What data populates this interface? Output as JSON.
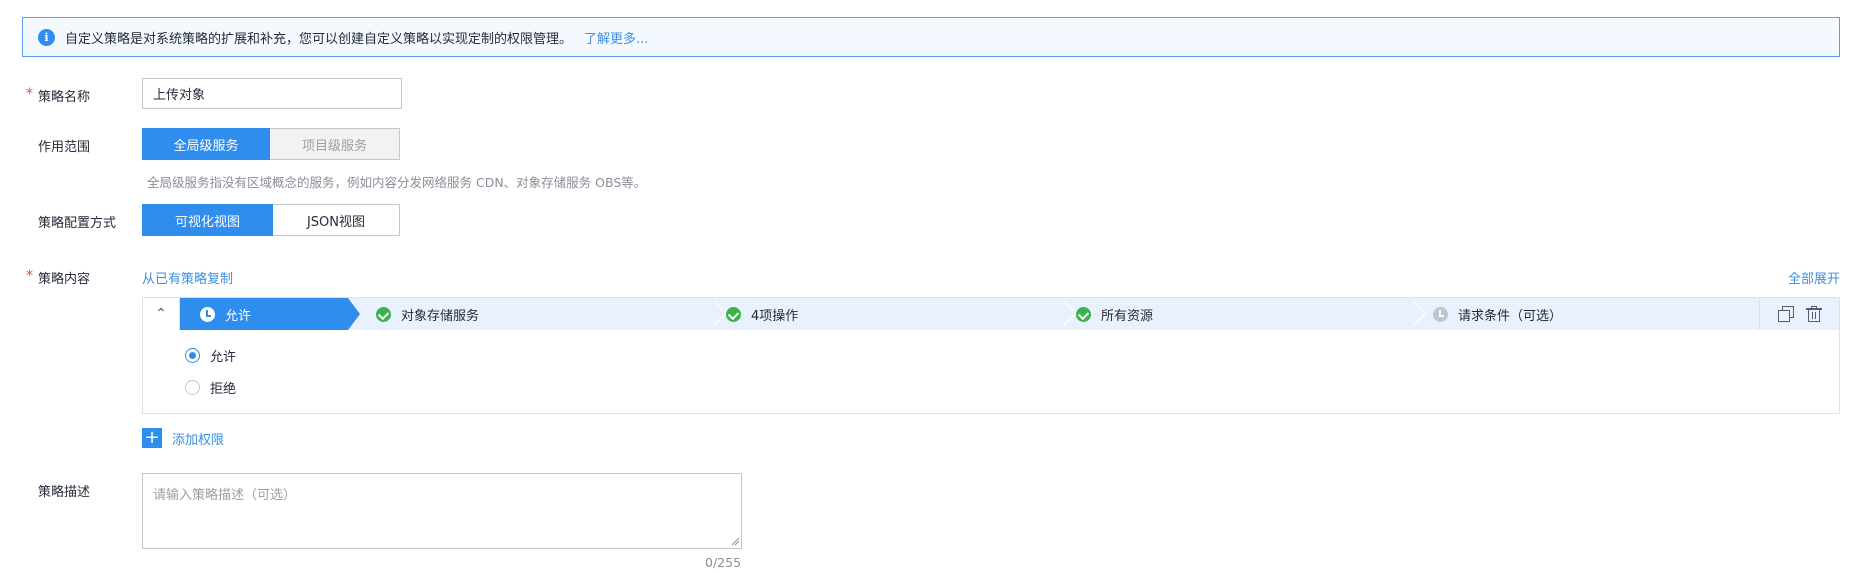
{
  "info": {
    "icon": "i",
    "text": "自定义策略是对系统策略的扩展和补充，您可以创建自定义策略以实现定制的权限管理。",
    "link": "了解更多..."
  },
  "policy_name": {
    "required_mark": "*",
    "label": "策略名称",
    "value": "上传对象"
  },
  "scope": {
    "label": "作用范围",
    "options": [
      "全局级服务",
      "项目级服务"
    ],
    "selected": "全局级服务",
    "hint": "全局级服务指没有区域概念的服务，例如内容分发网络服务 CDN、对象存储服务 OBS等。"
  },
  "config_mode": {
    "label": "策略配置方式",
    "options": [
      "可视化视图",
      "JSON视图"
    ],
    "selected": "可视化视图"
  },
  "content": {
    "required_mark": "*",
    "label": "策略内容",
    "copy_link": "从已有策略复制",
    "expand_link": "全部展开",
    "steps": [
      {
        "label": "允许",
        "state": "active"
      },
      {
        "label": "对象存储服务",
        "state": "done"
      },
      {
        "label": "4项操作",
        "state": "done"
      },
      {
        "label": "所有资源",
        "state": "done"
      },
      {
        "label": "请求条件（可选）",
        "state": "pending"
      }
    ],
    "radios": [
      {
        "label": "允许",
        "checked": true
      },
      {
        "label": "拒绝",
        "checked": false
      }
    ],
    "add_label": "添加权限"
  },
  "description": {
    "label": "策略描述",
    "placeholder": "请输入策略描述（可选）",
    "counter": "0/255"
  },
  "colors": {
    "accent": "#2e8ded",
    "success": "#3db24b",
    "required": "#e44b35",
    "link": "#3b8fe4"
  }
}
